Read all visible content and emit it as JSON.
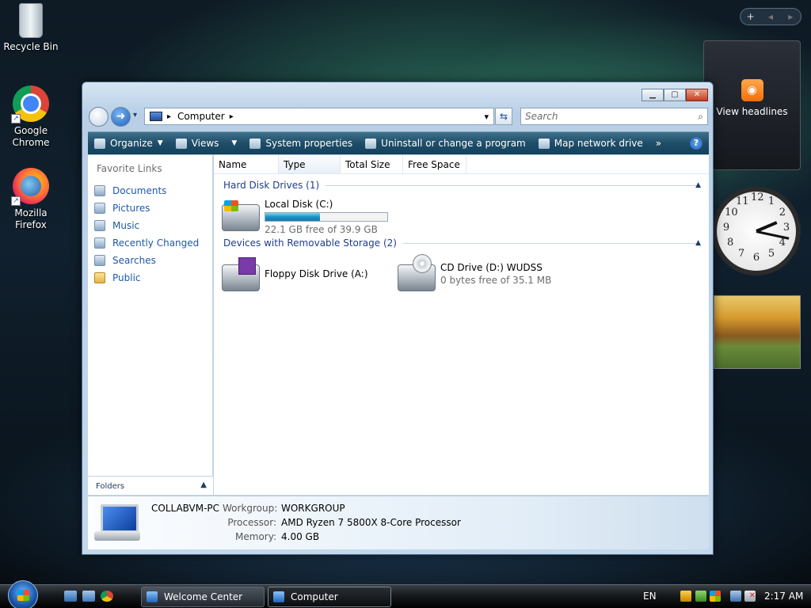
{
  "desktop": {
    "icons": [
      {
        "label": "Recycle Bin"
      },
      {
        "label": "Google Chrome"
      },
      {
        "label": "Mozilla Firefox"
      }
    ]
  },
  "gadgets": {
    "control_add": "+",
    "control_prev": "◂",
    "control_next": "▸",
    "feed_label": "View headlines",
    "clock_numbers": [
      "12",
      "1",
      "2",
      "3",
      "4",
      "5",
      "6",
      "7",
      "8",
      "9",
      "10",
      "11"
    ]
  },
  "window": {
    "buttons": {
      "minimize": "▁",
      "maximize": "▢",
      "close": "✕"
    },
    "address": {
      "location": "Computer",
      "arrow": "▸",
      "dropdown": "▾"
    },
    "search": {
      "placeholder": "Search"
    },
    "toolbar": {
      "organize": "Organize",
      "views": "Views",
      "system_properties": "System properties",
      "uninstall": "Uninstall or change a program",
      "map_drive": "Map network drive",
      "more": "»",
      "help": "?"
    },
    "favorites": {
      "title": "Favorite Links",
      "items": [
        {
          "label": "Documents"
        },
        {
          "label": "Pictures"
        },
        {
          "label": "Music"
        },
        {
          "label": "Recently Changed"
        },
        {
          "label": "Searches"
        },
        {
          "label": "Public"
        }
      ],
      "folders_label": "Folders",
      "folders_chevron": "▲"
    },
    "columns": [
      "Name",
      "Type",
      "Total Size",
      "Free Space"
    ],
    "groups": {
      "hard_disks": {
        "title": "Hard Disk Drives (1)",
        "chevron": "▲"
      },
      "removable": {
        "title": "Devices with Removable Storage (2)",
        "chevron": "▲"
      }
    },
    "drives": {
      "c": {
        "name": "Local Disk (C:)",
        "free_text": "22.1 GB free of 39.9 GB",
        "used_fraction": 0.446
      },
      "a": {
        "name": "Floppy Disk Drive (A:)"
      },
      "d": {
        "name": "CD Drive (D:) WUDSS",
        "free_text": "0 bytes free of 35.1 MB"
      }
    },
    "details": {
      "computer_name": "COLLABVM-PC",
      "workgroup_label": "Workgroup:",
      "workgroup": "WORKGROUP",
      "processor_label": "Processor:",
      "processor": "AMD Ryzen 7 5800X 8-Core Processor",
      "memory_label": "Memory:",
      "memory": "4.00 GB"
    }
  },
  "taskbar": {
    "tasks": [
      {
        "label": "Welcome Center"
      },
      {
        "label": "Computer"
      }
    ],
    "language": "EN",
    "time": "2:17 AM"
  }
}
